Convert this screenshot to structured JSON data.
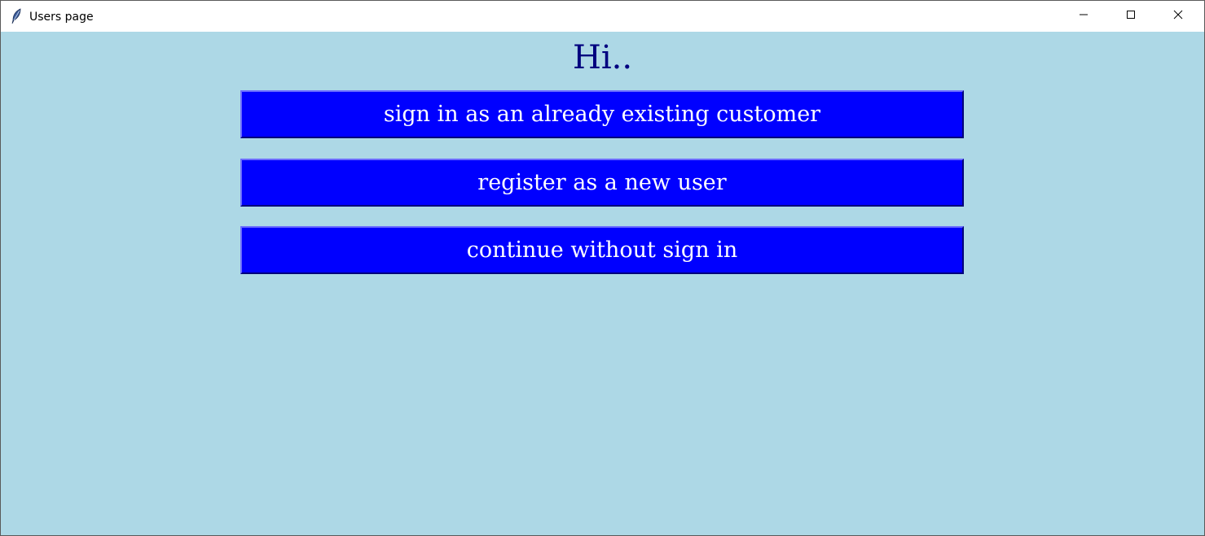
{
  "window": {
    "title": "Users page",
    "icon": "feather-icon",
    "controls": [
      "minimize-icon",
      "maximize-icon",
      "close-icon"
    ]
  },
  "main": {
    "greeting": "Hi..",
    "buttons": [
      {
        "label": "sign in as an already existing customer"
      },
      {
        "label": "register as a new user"
      },
      {
        "label": "continue without sign in"
      }
    ]
  },
  "colors": {
    "background": "#add8e6",
    "button": "#0000ff",
    "button_text": "#ffffff",
    "greeting": "#00007f"
  }
}
